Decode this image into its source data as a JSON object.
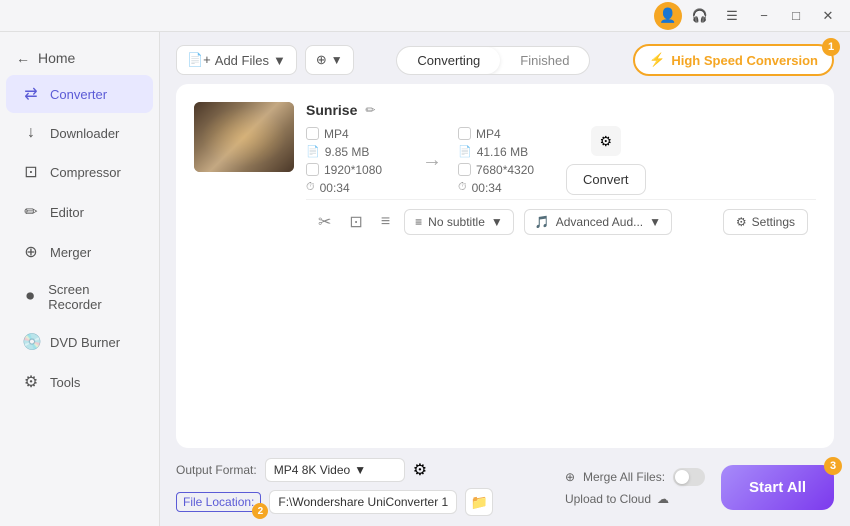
{
  "titlebar": {
    "badge1_label": "1",
    "minimize_icon": "−",
    "maximize_icon": "□",
    "close_icon": "✕"
  },
  "sidebar": {
    "home_label": "Home",
    "items": [
      {
        "id": "converter",
        "label": "Converter",
        "icon": "⇄",
        "active": true
      },
      {
        "id": "downloader",
        "label": "Downloader",
        "icon": "↓"
      },
      {
        "id": "compressor",
        "label": "Compressor",
        "icon": "⊡"
      },
      {
        "id": "editor",
        "label": "Editor",
        "icon": "✏️"
      },
      {
        "id": "merger",
        "label": "Merger",
        "icon": "⊕"
      },
      {
        "id": "screen-recorder",
        "label": "Screen Recorder",
        "icon": "⏺"
      },
      {
        "id": "dvd-burner",
        "label": "DVD Burner",
        "icon": "💿"
      },
      {
        "id": "tools",
        "label": "Tools",
        "icon": "⚙"
      }
    ]
  },
  "toolbar": {
    "add_file_label": "Add Files",
    "add_icon": "+",
    "tab_converting": "Converting",
    "tab_finished": "Finished",
    "high_speed_label": "High Speed Conversion",
    "lightning_icon": "⚡",
    "badge1": "1"
  },
  "video": {
    "title": "Sunrise",
    "edit_icon": "✏",
    "src_format": "MP4",
    "src_resolution": "1920*1080",
    "src_size": "9.85 MB",
    "src_duration": "00:34",
    "dst_format": "MP4",
    "dst_resolution": "7680*4320",
    "dst_size": "41.16 MB",
    "dst_duration": "00:34",
    "arrow": "→",
    "convert_btn": "Convert",
    "subtitle_label": "No subtitle",
    "audio_label": "Advanced Aud...",
    "settings_label": "Settings",
    "cut_icon": "✂",
    "crop_icon": "⊡",
    "adjust_icon": "≡"
  },
  "bottom": {
    "output_format_label": "Output Format:",
    "output_format_value": "MP4 8K Video",
    "output_format_icon": "▼",
    "file_location_label": "File Location:",
    "badge2": "2",
    "file_path_value": "F:\\Wondershare UniConverter 1",
    "folder_icon": "📁",
    "merge_label": "Merge All Files:",
    "upload_label": "Upload to Cloud",
    "upload_icon": "☁",
    "merge_icon": "⊕",
    "start_all_label": "Start All",
    "badge3": "3"
  }
}
